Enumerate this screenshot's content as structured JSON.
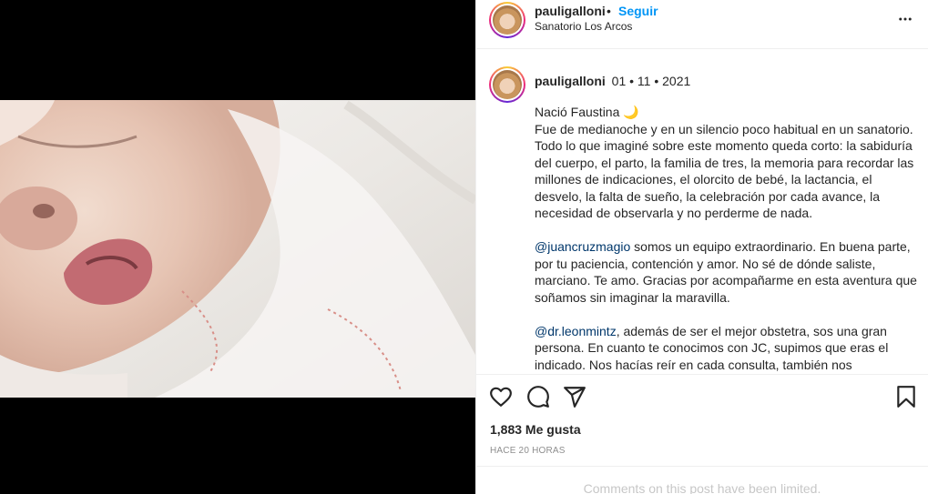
{
  "header": {
    "username": "pauligalloni",
    "separator": "•",
    "follow_label": "Seguir",
    "location": "Sanatorio Los Arcos"
  },
  "post": {
    "username": "pauligalloni",
    "date": "01 • 11 • 2021",
    "caption": {
      "p1_line1": "Nació Faustina 🌙",
      "p1_body": "Fue de medianoche y en un silencio poco habitual en un sanatorio. Todo lo que imaginé sobre este momento queda corto: la sabiduría del cuerpo, el parto, la familia de tres, la memoria para recordar las millones de indicaciones, el olorcito de bebé, la lactancia, el desvelo, la falta de sueño, la celebración por cada avance, la necesidad de observarla y no perderme de nada.",
      "p2_mention": "@juancruzmagio",
      "p2_body": " somos un equipo extraordinario. En buena parte, por tu paciencia, contención y amor. No sé de dónde saliste, marciano. Te amo. Gracias por acompañarme en esta aventura que soñamos sin imaginar la maravilla.",
      "p3_mention": "@dr.leonmintz",
      "p3_body": ", además de ser el mejor obstetra, sos una gran persona. En cuanto te conocimos con JC, supimos que eras el indicado. Nos hacías reír en cada consulta, también nos"
    }
  },
  "stats": {
    "likes": "1,883 Me gusta",
    "time_ago": "HACE 20 HORAS"
  },
  "footer": {
    "limited_text": "Comments on this post have been limited."
  },
  "icons": {
    "more": "more-options-icon",
    "like": "heart-icon",
    "comment": "comment-icon",
    "share": "share-icon",
    "save": "bookmark-icon"
  }
}
